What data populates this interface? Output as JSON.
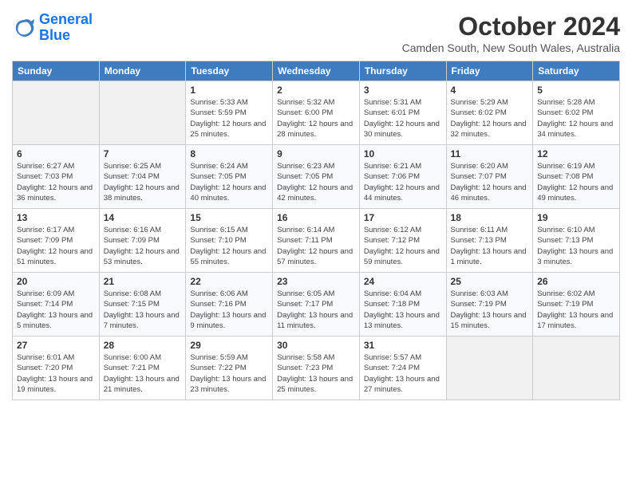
{
  "header": {
    "logo_line1": "General",
    "logo_line2": "Blue",
    "month": "October 2024",
    "location": "Camden South, New South Wales, Australia"
  },
  "weekdays": [
    "Sunday",
    "Monday",
    "Tuesday",
    "Wednesday",
    "Thursday",
    "Friday",
    "Saturday"
  ],
  "weeks": [
    [
      {
        "day": "",
        "empty": true
      },
      {
        "day": "",
        "empty": true
      },
      {
        "day": "1",
        "sunrise": "Sunrise: 5:33 AM",
        "sunset": "Sunset: 5:59 PM",
        "daylight": "Daylight: 12 hours and 25 minutes."
      },
      {
        "day": "2",
        "sunrise": "Sunrise: 5:32 AM",
        "sunset": "Sunset: 6:00 PM",
        "daylight": "Daylight: 12 hours and 28 minutes."
      },
      {
        "day": "3",
        "sunrise": "Sunrise: 5:31 AM",
        "sunset": "Sunset: 6:01 PM",
        "daylight": "Daylight: 12 hours and 30 minutes."
      },
      {
        "day": "4",
        "sunrise": "Sunrise: 5:29 AM",
        "sunset": "Sunset: 6:02 PM",
        "daylight": "Daylight: 12 hours and 32 minutes."
      },
      {
        "day": "5",
        "sunrise": "Sunrise: 5:28 AM",
        "sunset": "Sunset: 6:02 PM",
        "daylight": "Daylight: 12 hours and 34 minutes."
      }
    ],
    [
      {
        "day": "6",
        "sunrise": "Sunrise: 6:27 AM",
        "sunset": "Sunset: 7:03 PM",
        "daylight": "Daylight: 12 hours and 36 minutes."
      },
      {
        "day": "7",
        "sunrise": "Sunrise: 6:25 AM",
        "sunset": "Sunset: 7:04 PM",
        "daylight": "Daylight: 12 hours and 38 minutes."
      },
      {
        "day": "8",
        "sunrise": "Sunrise: 6:24 AM",
        "sunset": "Sunset: 7:05 PM",
        "daylight": "Daylight: 12 hours and 40 minutes."
      },
      {
        "day": "9",
        "sunrise": "Sunrise: 6:23 AM",
        "sunset": "Sunset: 7:05 PM",
        "daylight": "Daylight: 12 hours and 42 minutes."
      },
      {
        "day": "10",
        "sunrise": "Sunrise: 6:21 AM",
        "sunset": "Sunset: 7:06 PM",
        "daylight": "Daylight: 12 hours and 44 minutes."
      },
      {
        "day": "11",
        "sunrise": "Sunrise: 6:20 AM",
        "sunset": "Sunset: 7:07 PM",
        "daylight": "Daylight: 12 hours and 46 minutes."
      },
      {
        "day": "12",
        "sunrise": "Sunrise: 6:19 AM",
        "sunset": "Sunset: 7:08 PM",
        "daylight": "Daylight: 12 hours and 49 minutes."
      }
    ],
    [
      {
        "day": "13",
        "sunrise": "Sunrise: 6:17 AM",
        "sunset": "Sunset: 7:09 PM",
        "daylight": "Daylight: 12 hours and 51 minutes."
      },
      {
        "day": "14",
        "sunrise": "Sunrise: 6:16 AM",
        "sunset": "Sunset: 7:09 PM",
        "daylight": "Daylight: 12 hours and 53 minutes."
      },
      {
        "day": "15",
        "sunrise": "Sunrise: 6:15 AM",
        "sunset": "Sunset: 7:10 PM",
        "daylight": "Daylight: 12 hours and 55 minutes."
      },
      {
        "day": "16",
        "sunrise": "Sunrise: 6:14 AM",
        "sunset": "Sunset: 7:11 PM",
        "daylight": "Daylight: 12 hours and 57 minutes."
      },
      {
        "day": "17",
        "sunrise": "Sunrise: 6:12 AM",
        "sunset": "Sunset: 7:12 PM",
        "daylight": "Daylight: 12 hours and 59 minutes."
      },
      {
        "day": "18",
        "sunrise": "Sunrise: 6:11 AM",
        "sunset": "Sunset: 7:13 PM",
        "daylight": "Daylight: 13 hours and 1 minute."
      },
      {
        "day": "19",
        "sunrise": "Sunrise: 6:10 AM",
        "sunset": "Sunset: 7:13 PM",
        "daylight": "Daylight: 13 hours and 3 minutes."
      }
    ],
    [
      {
        "day": "20",
        "sunrise": "Sunrise: 6:09 AM",
        "sunset": "Sunset: 7:14 PM",
        "daylight": "Daylight: 13 hours and 5 minutes."
      },
      {
        "day": "21",
        "sunrise": "Sunrise: 6:08 AM",
        "sunset": "Sunset: 7:15 PM",
        "daylight": "Daylight: 13 hours and 7 minutes."
      },
      {
        "day": "22",
        "sunrise": "Sunrise: 6:06 AM",
        "sunset": "Sunset: 7:16 PM",
        "daylight": "Daylight: 13 hours and 9 minutes."
      },
      {
        "day": "23",
        "sunrise": "Sunrise: 6:05 AM",
        "sunset": "Sunset: 7:17 PM",
        "daylight": "Daylight: 13 hours and 11 minutes."
      },
      {
        "day": "24",
        "sunrise": "Sunrise: 6:04 AM",
        "sunset": "Sunset: 7:18 PM",
        "daylight": "Daylight: 13 hours and 13 minutes."
      },
      {
        "day": "25",
        "sunrise": "Sunrise: 6:03 AM",
        "sunset": "Sunset: 7:19 PM",
        "daylight": "Daylight: 13 hours and 15 minutes."
      },
      {
        "day": "26",
        "sunrise": "Sunrise: 6:02 AM",
        "sunset": "Sunset: 7:19 PM",
        "daylight": "Daylight: 13 hours and 17 minutes."
      }
    ],
    [
      {
        "day": "27",
        "sunrise": "Sunrise: 6:01 AM",
        "sunset": "Sunset: 7:20 PM",
        "daylight": "Daylight: 13 hours and 19 minutes."
      },
      {
        "day": "28",
        "sunrise": "Sunrise: 6:00 AM",
        "sunset": "Sunset: 7:21 PM",
        "daylight": "Daylight: 13 hours and 21 minutes."
      },
      {
        "day": "29",
        "sunrise": "Sunrise: 5:59 AM",
        "sunset": "Sunset: 7:22 PM",
        "daylight": "Daylight: 13 hours and 23 minutes."
      },
      {
        "day": "30",
        "sunrise": "Sunrise: 5:58 AM",
        "sunset": "Sunset: 7:23 PM",
        "daylight": "Daylight: 13 hours and 25 minutes."
      },
      {
        "day": "31",
        "sunrise": "Sunrise: 5:57 AM",
        "sunset": "Sunset: 7:24 PM",
        "daylight": "Daylight: 13 hours and 27 minutes."
      },
      {
        "day": "",
        "empty": true
      },
      {
        "day": "",
        "empty": true
      }
    ]
  ]
}
